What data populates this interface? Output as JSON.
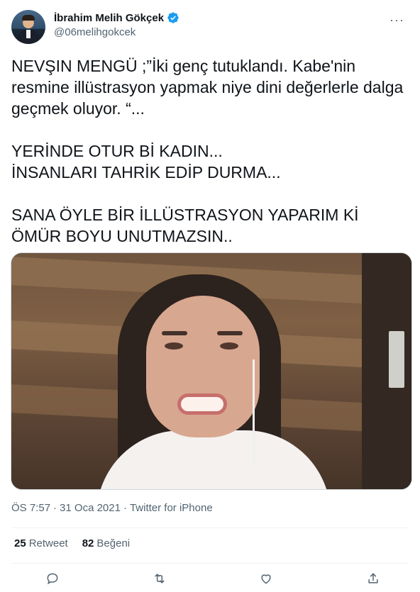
{
  "author": {
    "display_name": "İbrahim Melih Gökçek",
    "handle": "@06melihgokcek",
    "verified": true,
    "more_icon": "more-horizontal-icon"
  },
  "tweet": {
    "paragraphs": [
      "NEVŞIN MENGÜ ;”İki genç tutuklandı. Kabe'nin resmine illüstrasyon yapmak niye dini değerlerle dalga geçmek oluyor. “...",
      "YERİNDE OTUR Bİ KADIN...\nİNSANLARI TAHRİK EDİP DURMA...",
      "SANA ÖYLE BİR İLLÜSTRASYON YAPARIM Kİ\nÖMÜR BOYU UNUTMAZSIN.."
    ]
  },
  "meta": {
    "time": "ÖS 7:57",
    "date": "31 Oca 2021",
    "source": "Twitter for iPhone",
    "separator": "·"
  },
  "stats": {
    "retweets_count": "25",
    "retweets_label": "Retweet",
    "likes_count": "82",
    "likes_label": "Beğeni"
  },
  "actions": [
    {
      "icon": "reply-icon"
    },
    {
      "icon": "retweet-icon"
    },
    {
      "icon": "like-icon"
    },
    {
      "icon": "share-icon"
    }
  ],
  "colors": {
    "text": "#0f1419",
    "secondary": "#536471",
    "verified_blue": "#1d9bf0",
    "divider": "#eff3f4"
  }
}
